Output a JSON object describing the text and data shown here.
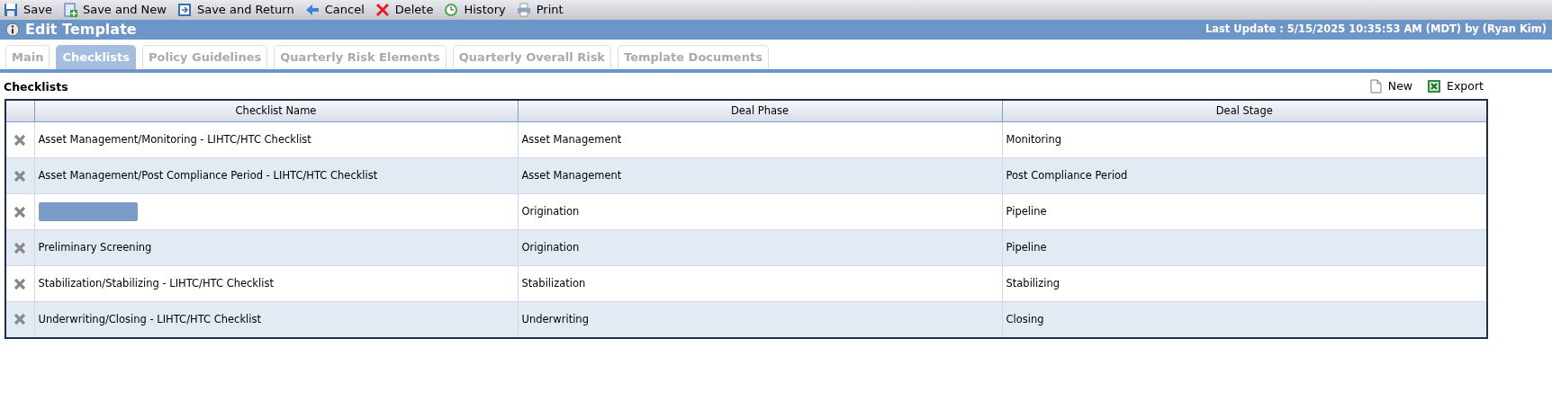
{
  "toolbar": [
    {
      "label": "Save",
      "kind": "save"
    },
    {
      "label": "Save and New",
      "kind": "savenew"
    },
    {
      "label": "Save and Return",
      "kind": "savereturn"
    },
    {
      "label": "Cancel",
      "kind": "cancel"
    },
    {
      "label": "Delete",
      "kind": "delete"
    },
    {
      "label": "History",
      "kind": "history"
    },
    {
      "label": "Print",
      "kind": "print"
    }
  ],
  "header": {
    "title": "Edit Template",
    "last_update": "Last Update : 5/15/2025 10:35:53 AM (MDT) by (Ryan Kim)"
  },
  "tabs": [
    {
      "label": "Main",
      "selected": false
    },
    {
      "label": "Checklists",
      "selected": true
    },
    {
      "label": "Policy Guidelines",
      "selected": false
    },
    {
      "label": "Quarterly Risk Elements",
      "selected": false
    },
    {
      "label": "Quarterly Overall Risk",
      "selected": false
    },
    {
      "label": "Template Documents",
      "selected": false
    }
  ],
  "section": {
    "title": "Checklists",
    "actions": [
      {
        "label": "New",
        "kind": "new"
      },
      {
        "label": "Export",
        "kind": "export"
      }
    ]
  },
  "table": {
    "columns": [
      "Checklist Name",
      "Deal Phase",
      "Deal Stage"
    ],
    "rows": [
      {
        "name": "Asset Management/Monitoring - LIHTC/HTC Checklist",
        "phase": "Asset Management",
        "stage": "Monitoring"
      },
      {
        "name": "Asset Management/Post Compliance Period - LIHTC/HTC Checklist",
        "phase": "Asset Management",
        "stage": "Post Compliance Period"
      },
      {
        "redacted": true,
        "phase": "Origination",
        "stage": "Pipeline"
      },
      {
        "name": "Preliminary Screening",
        "phase": "Origination",
        "stage": "Pipeline"
      },
      {
        "name": "Stabilization/Stabilizing - LIHTC/HTC Checklist",
        "phase": "Stabilization",
        "stage": "Stabilizing"
      },
      {
        "name": "Underwriting/Closing - LIHTC/HTC Checklist",
        "phase": "Underwriting",
        "stage": "Closing"
      }
    ]
  }
}
